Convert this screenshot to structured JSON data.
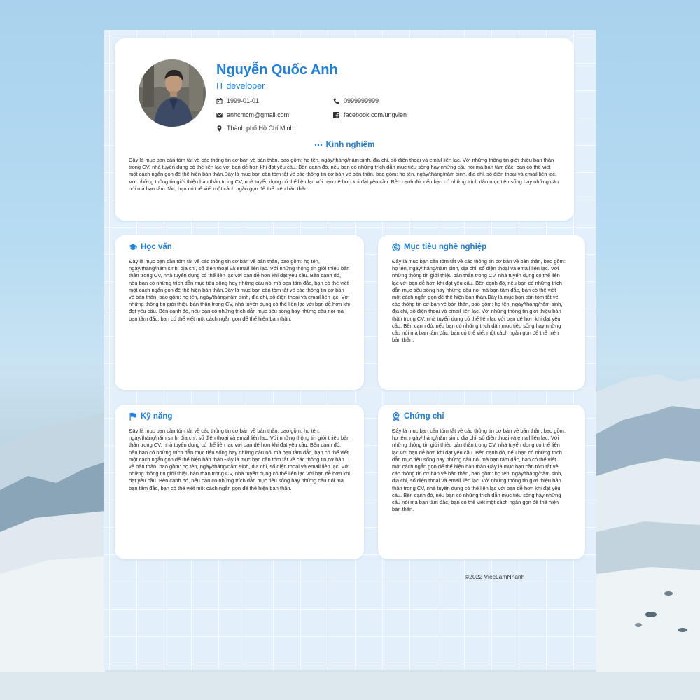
{
  "profile": {
    "name": "Nguyễn Quốc Anh",
    "role": "IT developer",
    "birthdate": "1999-01-01",
    "phone": "0999999999",
    "email": "anhcmcm@gmail.com",
    "facebook": "facebook.com/ungvien",
    "address": "Thành phố Hồ Chí Minh"
  },
  "experience": {
    "title": "Kinh nghiệm",
    "text": "Đây là mục bạn cần tóm tắt về các thông tin cơ bản về bản thân, bao gồm: họ tên, ngày/tháng/năm sinh, địa chỉ, số điện thoại và email liên lạc. Với những thông tin giới thiệu bản thân trong CV, nhà tuyển dụng có thể liên lạc với bạn dễ hơn khi đạt yêu cầu. Bên cạnh đó, nếu bạn có những trích dẫn mục tiêu sống hay những câu nói mà bạn tâm đắc, bạn có thể viết một cách ngắn gọn để thể hiện bản thân.Đây là mục bạn cần tóm tắt về các thông tin cơ bản về bản thân, bao gồm: họ tên, ngày/tháng/năm sinh, địa chỉ, số điện thoại và email liên lạc. Với những thông tin giới thiệu bản thân trong CV, nhà tuyển dụng có thể liên lạc với bạn dễ hơn khi đạt yêu cầu. Bên cạnh đó, nếu bạn có những trích dẫn mục tiêu sống hay những câu nói mà bạn tâm đắc, bạn có thể viết một cách ngắn gọn để thể hiện bản thân."
  },
  "education": {
    "title": "Học vấn",
    "text": "Đây là mục bạn cần tóm tắt về các thông tin cơ bản về bản thân, bao gồm: họ tên, ngày/tháng/năm sinh, địa chỉ, số điện thoại và email liên lạc. Với những thông tin giới thiệu bản thân trong CV, nhà tuyển dụng có thể liên lạc với bạn dễ hơn khi đạt yêu cầu. Bên cạnh đó, nếu bạn có những trích dẫn mục tiêu sống hay những câu nói mà bạn tâm đắc, bạn có thể viết một cách ngắn gọn để thể hiện bản thân.Đây là mục bạn cần tóm tắt về các thông tin cơ bản về bản thân, bao gồm: họ tên, ngày/tháng/năm sinh, địa chỉ, số điện thoại và email liên lạc. Với những thông tin giới thiệu bản thân trong CV, nhà tuyển dụng có thể liên lạc với bạn dễ hơn khi đạt yêu cầu. Bên cạnh đó, nếu bạn có những trích dẫn mục tiêu sống hay những câu nói mà bạn tâm đắc, bạn có thể viết một cách ngắn gọn để thể hiện bản thân."
  },
  "career_goal": {
    "title": "Mục tiêu nghề nghiệp",
    "text": "Đây là mục bạn cần tóm tắt về các thông tin cơ bản về bản thân, bao gồm: họ tên, ngày/tháng/năm sinh, địa chỉ, số điện thoại và email liên lạc. Với những thông tin giới thiệu bản thân trong CV, nhà tuyển dụng có thể liên lạc với bạn dễ hơn khi đạt yêu cầu. Bên cạnh đó, nếu bạn có những trích dẫn mục tiêu sống hay những câu nói mà bạn tâm đắc, bạn có thể viết một cách ngắn gọn để thể hiện bản thân.Đây là mục bạn cần tóm tắt về các thông tin cơ bản về bản thân, bao gồm: họ tên, ngày/tháng/năm sinh, địa chỉ, số điện thoại và email liên lạc. Với những thông tin giới thiệu bản thân trong CV, nhà tuyển dụng có thể liên lạc với bạn dễ hơn khi đạt yêu cầu. Bên cạnh đó, nếu bạn có những trích dẫn mục tiêu sống hay những câu nói mà bạn tâm đắc, bạn có thể viết một cách ngắn gọn để thể hiện bản thân."
  },
  "skills": {
    "title": "Kỹ năng",
    "text": "Đây là mục bạn cần tóm tắt về các thông tin cơ bản về bản thân, bao gồm: họ tên, ngày/tháng/năm sinh, địa chỉ, số điện thoại và email liên lạc. Với những thông tin giới thiệu bản thân trong CV, nhà tuyển dụng có thể liên lạc với bạn dễ hơn khi đạt yêu cầu. Bên cạnh đó, nếu bạn có những trích dẫn mục tiêu sống hay những câu nói mà bạn tâm đắc, bạn có thể viết một cách ngắn gọn để thể hiện bản thân.Đây là mục bạn cần tóm tắt về các thông tin cơ bản về bản thân, bao gồm: họ tên, ngày/tháng/năm sinh, địa chỉ, số điện thoại và email liên lạc. Với những thông tin giới thiệu bản thân trong CV, nhà tuyển dụng có thể liên lạc với bạn dễ hơn khi đạt yêu cầu. Bên cạnh đó, nếu bạn có những trích dẫn mục tiêu sống hay những câu nói mà bạn tâm đắc, bạn có thể viết một cách ngắn gọn để thể hiện bản thân."
  },
  "certificates": {
    "title": "Chứng chỉ",
    "text": "Đây là mục bạn cần tóm tắt về các thông tin cơ bản về bản thân, bao gồm: họ tên, ngày/tháng/năm sinh, địa chỉ, số điện thoại và email liên lạc. Với những thông tin giới thiệu bản thân trong CV, nhà tuyển dụng có thể liên lạc với bạn dễ hơn khi đạt yêu cầu. Bên cạnh đó, nếu bạn có những trích dẫn mục tiêu sống hay những câu nói mà bạn tâm đắc, bạn có thể viết một cách ngắn gọn để thể hiện bản thân.Đây là mục bạn cần tóm tắt về các thông tin cơ bản về bản thân, bao gồm: họ tên, ngày/tháng/năm sinh, địa chỉ, số điện thoại và email liên lạc. Với những thông tin giới thiệu bản thân trong CV, nhà tuyển dụng có thể liên lạc với bạn dễ hơn khi đạt yêu cầu. Bên cạnh đó, nếu bạn có những trích dẫn mục tiêu sống hay những câu nói mà bạn tâm đắc, bạn có thể viết một cách ngắn gọn để thể hiện bản thân."
  },
  "footer": {
    "copyright": "©2022 ViecLamNhanh"
  },
  "icons": {
    "birthdate": "calendar-icon",
    "phone": "phone-icon",
    "email": "mail-icon",
    "facebook": "facebook-icon",
    "address": "map-pin-icon",
    "experience": "ellipsis-icon",
    "education": "graduation-cap-icon",
    "career_goal": "target-icon",
    "skills": "flag-icon",
    "certificates": "award-icon"
  },
  "colors": {
    "accent": "#1e7fe0",
    "paper": "#e3f0fc",
    "card": "#ffffff",
    "text": "#222222"
  }
}
